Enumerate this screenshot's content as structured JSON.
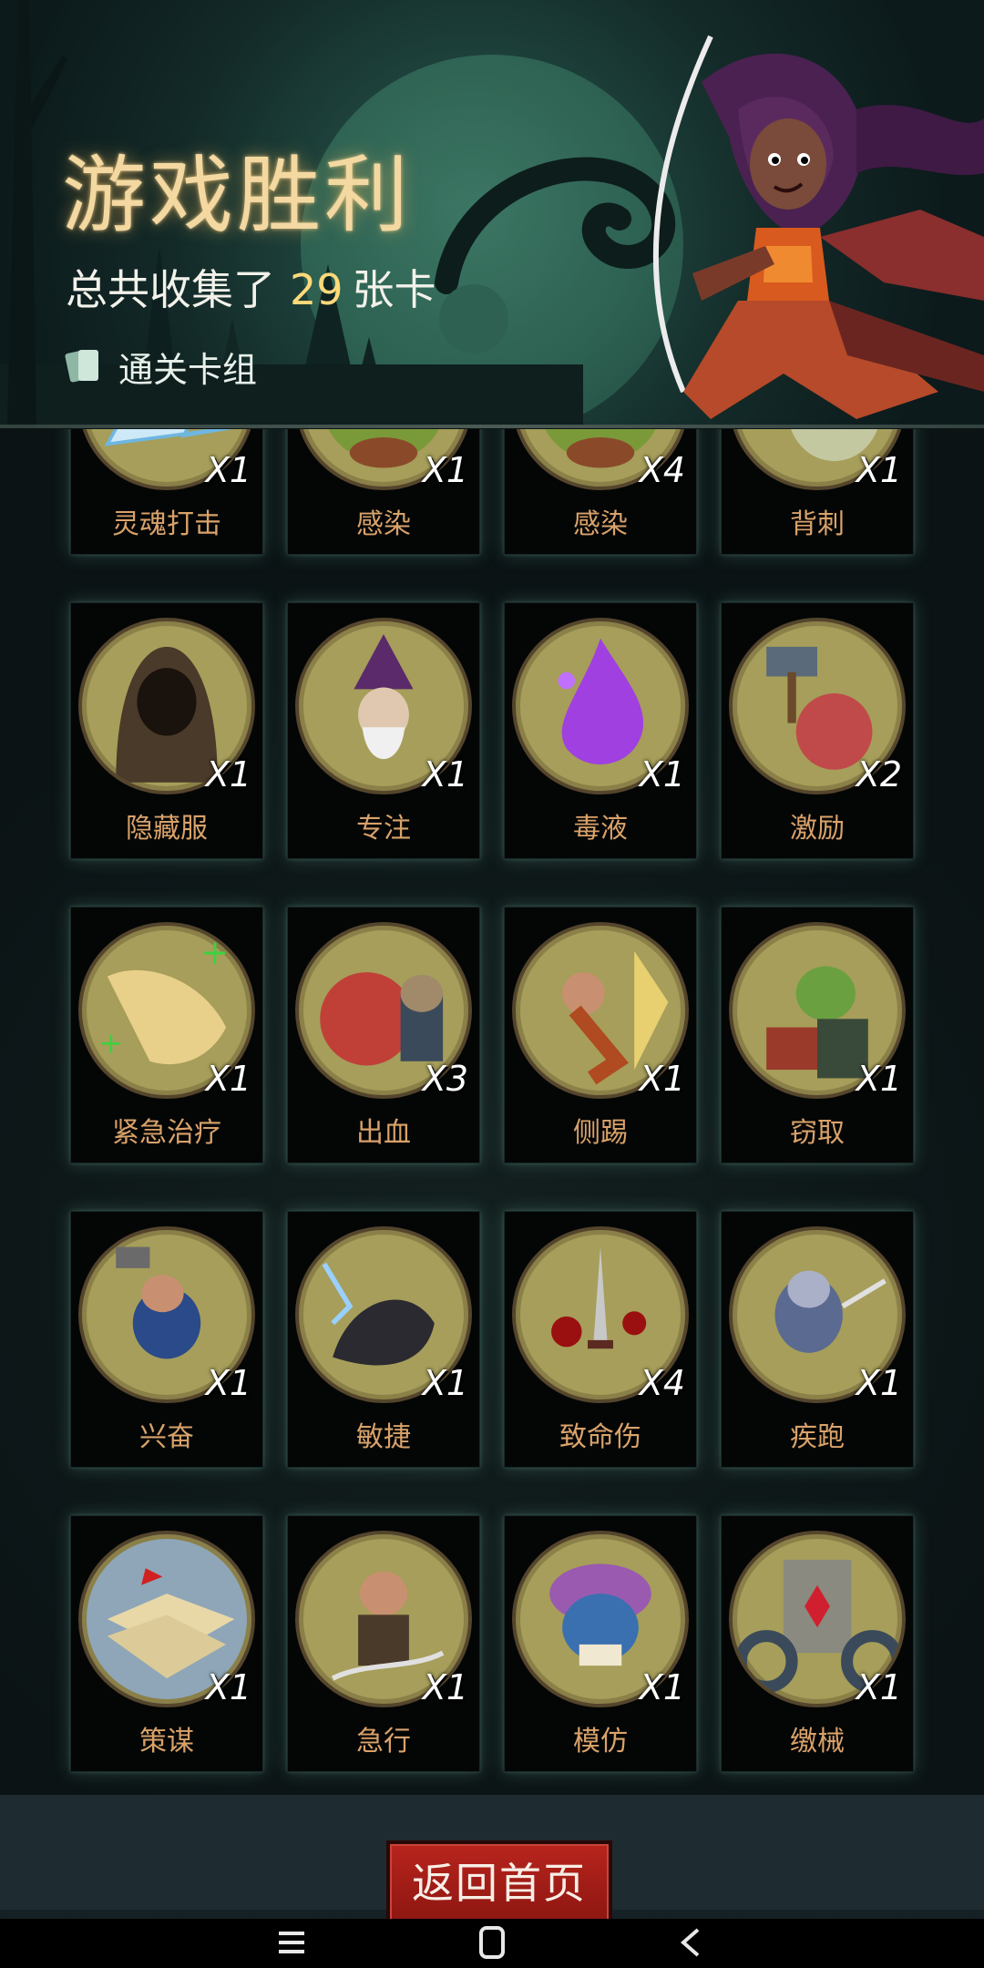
{
  "header": {
    "title": "游戏胜利",
    "collected_prefix": "总共收集了",
    "collected_count": "29",
    "collected_suffix": "张卡",
    "deck_link_label": "通关卡组"
  },
  "cards": [
    {
      "name": "灵魂打击",
      "count": "X1",
      "icon": "ice-crystal-icon",
      "bg": "#a69e5a"
    },
    {
      "name": "感染",
      "count": "X1",
      "icon": "plague-monster-icon",
      "bg": "#a69e5a"
    },
    {
      "name": "感染",
      "count": "X4",
      "icon": "plague-monster-icon",
      "bg": "#a69e5a"
    },
    {
      "name": "背刺",
      "count": "X1",
      "icon": "backstab-icon",
      "bg": "#a69e5a"
    },
    {
      "name": "隐藏服",
      "count": "X1",
      "icon": "hooded-cloak-icon",
      "bg": "#a69e5a"
    },
    {
      "name": "专注",
      "count": "X1",
      "icon": "wizard-icon",
      "bg": "#a69e5a"
    },
    {
      "name": "毒液",
      "count": "X1",
      "icon": "poison-splash-icon",
      "bg": "#a69e5a"
    },
    {
      "name": "激励",
      "count": "X2",
      "icon": "hammer-warrior-icon",
      "bg": "#a69e5a"
    },
    {
      "name": "紧急治疗",
      "count": "X1",
      "icon": "healing-scroll-icon",
      "bg": "#a69e5a"
    },
    {
      "name": "出血",
      "count": "X3",
      "icon": "octopus-icon",
      "bg": "#a69e5a"
    },
    {
      "name": "侧踢",
      "count": "X1",
      "icon": "kick-icon",
      "bg": "#a69e5a"
    },
    {
      "name": "窃取",
      "count": "X1",
      "icon": "goblin-thief-icon",
      "bg": "#a69e5a"
    },
    {
      "name": "兴奋",
      "count": "X1",
      "icon": "dwarf-hammer-icon",
      "bg": "#a69e5a"
    },
    {
      "name": "敏捷",
      "count": "X1",
      "icon": "panther-icon",
      "bg": "#a69e5a"
    },
    {
      "name": "致命伤",
      "count": "X4",
      "icon": "bloody-dagger-icon",
      "bg": "#a69e5a"
    },
    {
      "name": "疾跑",
      "count": "X1",
      "icon": "running-wolf-icon",
      "bg": "#a69e5a"
    },
    {
      "name": "策谋",
      "count": "X1",
      "icon": "battle-map-icon",
      "bg": "#8fa6b8"
    },
    {
      "name": "急行",
      "count": "X1",
      "icon": "dashing-warrior-icon",
      "bg": "#a69e5a"
    },
    {
      "name": "模仿",
      "count": "X1",
      "icon": "mask-troll-icon",
      "bg": "#a69e5a"
    },
    {
      "name": "缴械",
      "count": "X1",
      "icon": "shield-gear-icon",
      "bg": "#a69e5a"
    }
  ],
  "footer": {
    "home_button_label": "返回首页"
  },
  "nav": [
    "menu-icon",
    "home-icon",
    "back-icon"
  ],
  "colors": {
    "accent_title": "#f4d8a2",
    "count_highlight": "#ffd97a",
    "card_label": "#d9a26a",
    "home_button": "#a81e18"
  }
}
